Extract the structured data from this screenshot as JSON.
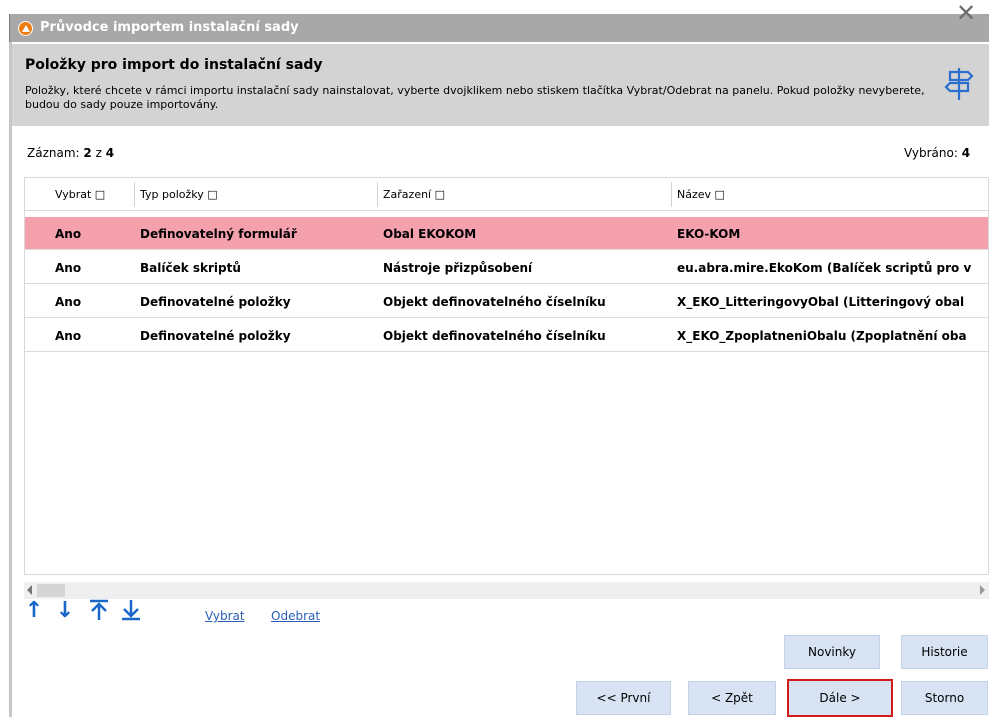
{
  "window": {
    "title": "Průvodce importem instalační sady"
  },
  "header": {
    "title": "Položky pro import do instalační sady",
    "description": "Položky, které chcete v rámci importu instalační sady nainstalovat, vyberte dvojklikem nebo stiskem tlačítka Vybrat/Odebrat na panelu. Pokud položky nevyberete, budou do sady pouze importovány."
  },
  "record": {
    "label": "Záznam:",
    "current": "2",
    "of": "z",
    "total": "4"
  },
  "selected": {
    "label": "Vybráno:",
    "value": "4"
  },
  "columns": [
    "Vybrat □",
    "Typ položky □",
    "Zařazení □",
    "Název □"
  ],
  "rows": [
    {
      "select": "Ano",
      "type": "Definovatelný formulář",
      "category": "Obal EKOKOM",
      "name": "EKO-KOM"
    },
    {
      "select": "Ano",
      "type": "Balíček skriptů",
      "category": "Nástroje přizpůsobení",
      "name": "eu.abra.mire.EkoKom (Balíček scriptů pro v"
    },
    {
      "select": "Ano",
      "type": "Definovatelné položky",
      "category": "Objekt definovatelného číselníku",
      "name": "X_EKO_LitteringovyObal (Litteringový obal"
    },
    {
      "select": "Ano",
      "type": "Definovatelné položky",
      "category": "Objekt definovatelného číselníku",
      "name": "X_EKO_ZpoplatneniObalu (Zpoplatnění oba"
    }
  ],
  "toolbar": {
    "select_link": "Vybrat",
    "remove_link": "Odebrat"
  },
  "buttons": {
    "news": "Novinky",
    "history": "Historie",
    "first": "<< První",
    "back": "< Zpět",
    "next": "Dále >",
    "cancel": "Storno"
  }
}
